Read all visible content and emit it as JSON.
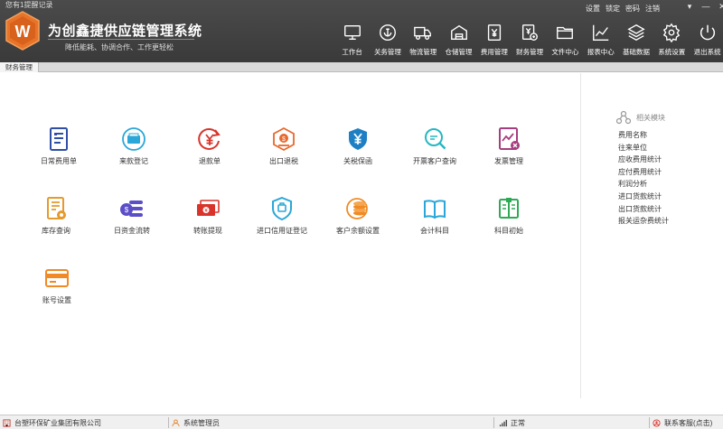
{
  "header": {
    "reminder": "您有1提醒记录",
    "title": "为创鑫捷供应链管理系统",
    "subtitle": "降低能耗、协调合作、工作更轻松",
    "logo_letter": "W"
  },
  "sys_links": [
    "设置",
    "锁定",
    "密码",
    "注销"
  ],
  "nav": [
    {
      "label": "工作台",
      "icon": "monitor-icon"
    },
    {
      "label": "关务管理",
      "icon": "anchor-icon"
    },
    {
      "label": "物流管理",
      "icon": "truck-icon"
    },
    {
      "label": "仓储管理",
      "icon": "warehouse-icon"
    },
    {
      "label": "费用管理",
      "icon": "yen-doc-icon"
    },
    {
      "label": "财务管理",
      "icon": "finance-doc-icon"
    },
    {
      "label": "文件中心",
      "icon": "folder-icon"
    },
    {
      "label": "报表中心",
      "icon": "line-chart-icon"
    },
    {
      "label": "基础数据",
      "icon": "layers-icon"
    },
    {
      "label": "系统设置",
      "icon": "gear-icon"
    },
    {
      "label": "退出系统",
      "icon": "power-icon"
    }
  ],
  "tab": {
    "label": "财务管理"
  },
  "modules": [
    {
      "label": "日常费用单",
      "icon": "document-list-icon",
      "color": "#2f4fa5"
    },
    {
      "label": "来款登记",
      "icon": "wallet-icon",
      "color": "#2aa7d8"
    },
    {
      "label": "退款单",
      "icon": "yen-refund-icon",
      "color": "#d9342b"
    },
    {
      "label": "出口退税",
      "icon": "tax-refund-icon",
      "color": "#e8682c"
    },
    {
      "label": "关税保函",
      "icon": "shield-yen-icon",
      "color": "#1e7fc4"
    },
    {
      "label": "开票客户查询",
      "icon": "search-chat-icon",
      "color": "#27b7c3"
    },
    {
      "label": "发票管理",
      "icon": "invoice-icon",
      "color": "#a63d7e"
    },
    {
      "label": "库存查询",
      "icon": "inventory-doc-icon",
      "color": "#e59a2c"
    },
    {
      "label": "日资金流转",
      "icon": "coin-flow-icon",
      "color": "#5b4fc7"
    },
    {
      "label": "转账提现",
      "icon": "cash-transfer-icon",
      "color": "#d9342b"
    },
    {
      "label": "进口信用证登记",
      "icon": "credit-shield-icon",
      "color": "#2aa7d8"
    },
    {
      "label": "客户余额设置",
      "icon": "coin-stack-icon",
      "color": "#f08a24"
    },
    {
      "label": "会计科目",
      "icon": "open-book-icon",
      "color": "#2aa7d8"
    },
    {
      "label": "科目初始",
      "icon": "book-check-icon",
      "color": "#2eaa55"
    },
    {
      "label": "账号设置",
      "icon": "card-icon",
      "color": "#f08a24"
    }
  ],
  "related": {
    "title": "相关模块",
    "items": [
      "费用名称",
      "往来单位",
      "应收费用统计",
      "应付费用统计",
      "利润分析",
      "进口货款统计",
      "出口货款统计",
      "报关运杂费统计"
    ]
  },
  "status": {
    "company": "台塑环保矿业集团有限公司",
    "user": "系统管理员",
    "network": "正常",
    "support": "联系客服(点击)"
  }
}
